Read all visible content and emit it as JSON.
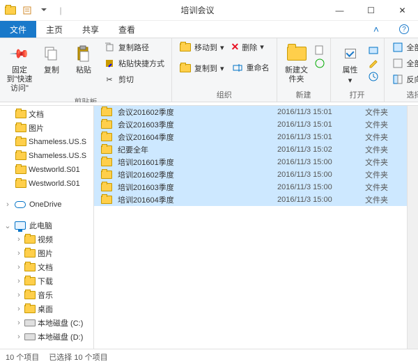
{
  "title": "培训会议",
  "title_sep": " | ",
  "window": {
    "min": "—",
    "max": "☐",
    "close": "✕"
  },
  "tabs": {
    "file": "文件",
    "home": "主页",
    "share": "共享",
    "view": "查看"
  },
  "ribbon": {
    "clipboard": {
      "pin": "固定到\"快速访问\"",
      "copy": "复制",
      "paste": "粘贴",
      "copy_path": "复制路径",
      "paste_shortcut": "粘贴快捷方式",
      "cut": "剪切",
      "label": "剪贴板"
    },
    "organize": {
      "move_to": "移动到",
      "copy_to": "复制到",
      "delete": "删除",
      "rename": "重命名",
      "label": "组织"
    },
    "new": {
      "new_folder": "新建文件夹",
      "label": "新建"
    },
    "open": {
      "properties": "属性",
      "label": "打开"
    },
    "select": {
      "select_all": "全部选择",
      "select_none": "全部取消",
      "invert": "反向选择",
      "label": "选择"
    }
  },
  "nav": {
    "items": [
      {
        "icon": "folder",
        "label": "文档",
        "level": 1
      },
      {
        "icon": "folder",
        "label": "图片",
        "level": 1
      },
      {
        "icon": "folder",
        "label": "Shameless.US.S",
        "level": 1
      },
      {
        "icon": "folder",
        "label": "Shameless.US.S",
        "level": 1
      },
      {
        "icon": "folder",
        "label": "Westworld.S01",
        "level": 1
      },
      {
        "icon": "folder",
        "label": "Westworld.S01",
        "level": 1
      }
    ],
    "onedrive": "OneDrive",
    "thispc": "此电脑",
    "pc": [
      {
        "label": "视频"
      },
      {
        "label": "图片"
      },
      {
        "label": "文档"
      },
      {
        "label": "下载"
      },
      {
        "label": "音乐"
      },
      {
        "label": "桌面"
      },
      {
        "label": "本地磁盘 (C:)"
      },
      {
        "label": "本地磁盘 (D:)"
      }
    ]
  },
  "files": [
    {
      "name": "会议201602季度",
      "date": "2016/11/3 15:01",
      "type": "文件夹"
    },
    {
      "name": "会议201603季度",
      "date": "2016/11/3 15:01",
      "type": "文件夹"
    },
    {
      "name": "会议201604季度",
      "date": "2016/11/3 15:01",
      "type": "文件夹"
    },
    {
      "name": "纪要全年",
      "date": "2016/11/3 15:02",
      "type": "文件夹"
    },
    {
      "name": "培训201601季度",
      "date": "2016/11/3 15:00",
      "type": "文件夹"
    },
    {
      "name": "培训201602季度",
      "date": "2016/11/3 15:00",
      "type": "文件夹"
    },
    {
      "name": "培训201603季度",
      "date": "2016/11/3 15:00",
      "type": "文件夹"
    },
    {
      "name": "培训201604季度",
      "date": "2016/11/3 15:00",
      "type": "文件夹"
    }
  ],
  "status": {
    "count": "10 个项目",
    "selected": "已选择 10 个项目"
  }
}
